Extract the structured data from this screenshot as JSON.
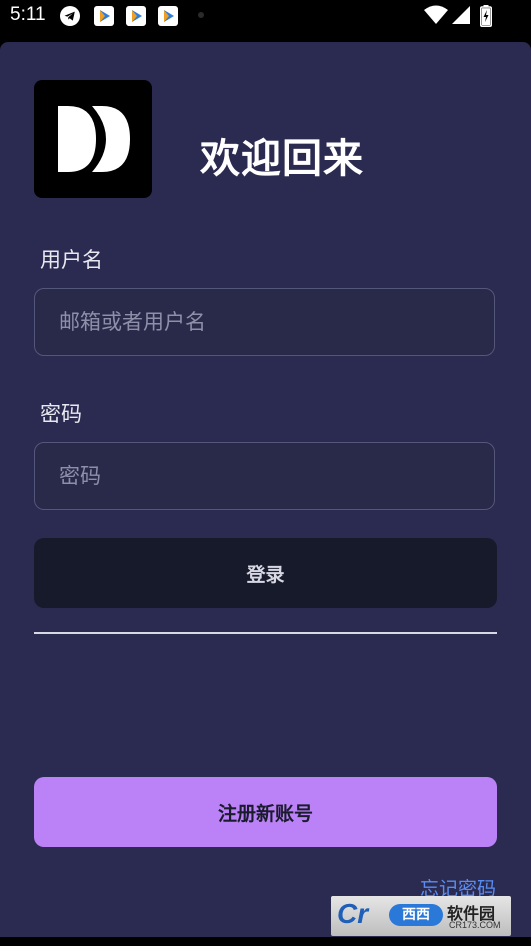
{
  "status_bar": {
    "time": "5:11",
    "notification_icons": [
      "telegram-icon",
      "app-icon",
      "app-icon",
      "app-icon"
    ],
    "system_icons": [
      "wifi-icon",
      "signal-icon",
      "battery-charging-icon"
    ]
  },
  "header": {
    "title": "欢迎回来",
    "logo_icon": "app-logo-icon"
  },
  "form": {
    "username_label": "用户名",
    "username_placeholder": "邮箱或者用户名",
    "password_label": "密码",
    "password_placeholder": "密码",
    "login_label": "登录"
  },
  "register_label": "注册新账号",
  "forgot_password": "忘记密码",
  "watermark": {
    "logo": "Cr",
    "brand": "西西",
    "name": "软件园",
    "url": "CR173.COM"
  },
  "colors": {
    "background": "#2b2a50",
    "primary_button": "#171a2b",
    "accent_button": "#bb82f7",
    "link": "#5a8df2"
  }
}
